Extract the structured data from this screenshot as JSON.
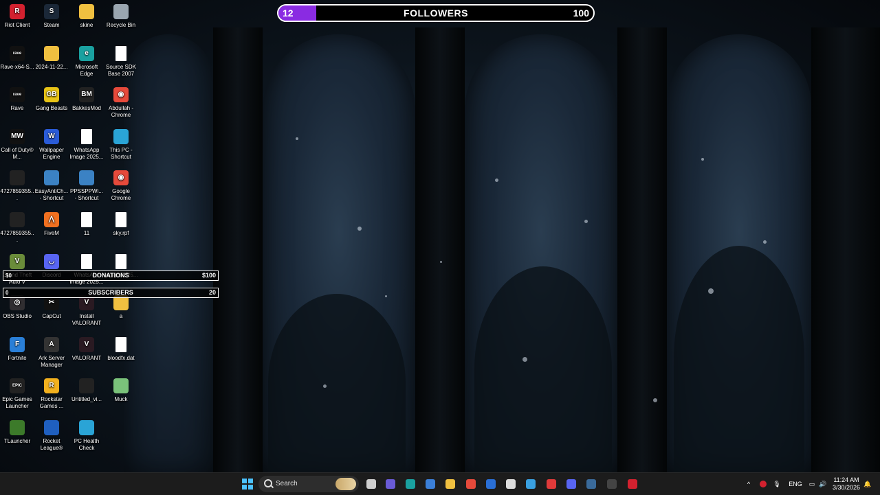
{
  "desktop_icons": [
    {
      "label": "Riot Client",
      "icon": "riot-client-icon",
      "color": "#d3212f",
      "glyph": "R"
    },
    {
      "label": "Steam",
      "icon": "steam-icon",
      "color": "#1b2838",
      "glyph": "S"
    },
    {
      "label": "skine",
      "icon": "folder-icon",
      "color": "#f0c040",
      "glyph": ""
    },
    {
      "label": "Recycle Bin",
      "icon": "recycle-bin-icon",
      "color": "#9aa6b0",
      "glyph": ""
    },
    {
      "label": "Rave-x64-S...",
      "icon": "rave-icon",
      "color": "#111111",
      "glyph": "rave"
    },
    {
      "label": "2024-11-22...",
      "icon": "folder-icon",
      "color": "#f0c040",
      "glyph": ""
    },
    {
      "label": "Microsoft Edge",
      "icon": "edge-icon",
      "color": "#1aa1a0",
      "glyph": "e"
    },
    {
      "label": "Source SDK Base 2007",
      "icon": "file-icon",
      "color": "#ffffff",
      "glyph": ""
    },
    {
      "label": "Rave",
      "icon": "rave-icon",
      "color": "#111111",
      "glyph": "rave"
    },
    {
      "label": "Gang Beasts",
      "icon": "gang-beasts-icon",
      "color": "#e7c316",
      "glyph": "GB"
    },
    {
      "label": "BakkesMod",
      "icon": "bakkesmod-icon",
      "color": "#222222",
      "glyph": "BM"
    },
    {
      "label": "Abdullah - Chrome",
      "icon": "chrome-icon",
      "color": "#e64a3b",
      "glyph": "◉"
    },
    {
      "label": "Call of Duty® M...",
      "icon": "call-of-duty-icon",
      "color": "#111111",
      "glyph": "MW"
    },
    {
      "label": "Wallpaper Engine",
      "icon": "wallpaper-engine-icon",
      "color": "#2a5bd7",
      "glyph": "W"
    },
    {
      "label": "WhatsApp Image 2025...",
      "icon": "image-file-icon",
      "color": "#ffffff",
      "glyph": ""
    },
    {
      "label": "This PC - Shortcut",
      "icon": "this-pc-icon",
      "color": "#2aa4d6",
      "glyph": ""
    },
    {
      "label": "4727859355...",
      "icon": "video-file-icon",
      "color": "#222222",
      "glyph": ""
    },
    {
      "label": "EasyAntiCh... - Shortcut",
      "icon": "easyanticheat-icon",
      "color": "#3b82c4",
      "glyph": ""
    },
    {
      "label": "PPSSPPWi... - Shortcut",
      "icon": "ppsspp-icon",
      "color": "#3b82c4",
      "glyph": ""
    },
    {
      "label": "Google Chrome",
      "icon": "chrome-icon",
      "color": "#e64a3b",
      "glyph": "◉"
    },
    {
      "label": "4727859355...",
      "icon": "video-file-icon",
      "color": "#222222",
      "glyph": ""
    },
    {
      "label": "FiveM",
      "icon": "fivem-icon",
      "color": "#f07020",
      "glyph": "⋀"
    },
    {
      "label": "11",
      "icon": "image-file-icon",
      "color": "#ffffff",
      "glyph": ""
    },
    {
      "label": "sky.rpf",
      "icon": "file-icon",
      "color": "#ffffff",
      "glyph": ""
    },
    {
      "label": "Grand Theft Auto V",
      "icon": "gta-v-icon",
      "color": "#6a8c3a",
      "glyph": "V"
    },
    {
      "label": "Discord",
      "icon": "discord-icon",
      "color": "#5865f2",
      "glyph": "◡"
    },
    {
      "label": "WhatsApp Image 2025...",
      "icon": "image-file-icon",
      "color": "#ffffff",
      "glyph": ""
    },
    {
      "label": "Image 2025...",
      "icon": "image-file-icon",
      "color": "#ffffff",
      "glyph": ""
    },
    {
      "label": "OBS Studio",
      "icon": "obs-studio-icon",
      "color": "#302e31",
      "glyph": "◎"
    },
    {
      "label": "CapCut",
      "icon": "capcut-icon",
      "color": "#111111",
      "glyph": "✂"
    },
    {
      "label": "Install VALORANT",
      "icon": "valorant-install-icon",
      "color": "#2a1a22",
      "glyph": "V"
    },
    {
      "label": "a",
      "icon": "folder-icon",
      "color": "#f0c040",
      "glyph": ""
    },
    {
      "label": "Fortnite",
      "icon": "fortnite-icon",
      "color": "#2a7fd7",
      "glyph": "F"
    },
    {
      "label": "Ark Server Manager",
      "icon": "ark-server-manager-icon",
      "color": "#333333",
      "glyph": "A"
    },
    {
      "label": "VALORANT",
      "icon": "valorant-icon",
      "color": "#2a1a22",
      "glyph": "V"
    },
    {
      "label": "bloodfx.dat",
      "icon": "file-icon",
      "color": "#ffffff",
      "glyph": ""
    },
    {
      "label": "Epic Games Launcher",
      "icon": "epic-games-icon",
      "color": "#222222",
      "glyph": "EPIC"
    },
    {
      "label": "Rockstar Games ...",
      "icon": "rockstar-icon",
      "color": "#f2b01e",
      "glyph": "R"
    },
    {
      "label": "Untitled_vi...",
      "icon": "video-file-icon",
      "color": "#222222",
      "glyph": ""
    },
    {
      "label": "Muck",
      "icon": "muck-icon",
      "color": "#7ac27a",
      "glyph": ""
    },
    {
      "label": "TLauncher",
      "icon": "tlauncher-icon",
      "color": "#3c7a2a",
      "glyph": ""
    },
    {
      "label": "Rocket League®",
      "icon": "rocket-league-icon",
      "color": "#1f5fbf",
      "glyph": ""
    },
    {
      "label": "PC Health Check",
      "icon": "pc-health-check-icon",
      "color": "#2aa4d6",
      "glyph": ""
    }
  ],
  "followers_goal": {
    "title": "FOLLOWERS",
    "current": "12",
    "goal": "100",
    "progress_fraction": 0.12,
    "fill_color": "#8a2be2"
  },
  "donations_goal": {
    "title": "DONATIONS",
    "current": "$0",
    "goal": "$100"
  },
  "subscribers_goal": {
    "title": "SUBSCRIBERS",
    "current": "0",
    "goal": "20"
  },
  "taskbar": {
    "search_label": "Search",
    "pinned": [
      {
        "name": "start-button",
        "icon": "windows-start-icon"
      },
      {
        "name": "task-view",
        "icon": "task-view-icon"
      },
      {
        "name": "copilot",
        "icon": "copilot-icon"
      },
      {
        "name": "edge",
        "icon": "edge-icon"
      },
      {
        "name": "microsoft-store",
        "icon": "store-icon"
      },
      {
        "name": "file-explorer",
        "icon": "folder-icon"
      },
      {
        "name": "chrome",
        "icon": "chrome-icon"
      },
      {
        "name": "mail",
        "icon": "mail-icon"
      },
      {
        "name": "capture",
        "icon": "capture-icon"
      },
      {
        "name": "network-app",
        "icon": "network-app-icon"
      },
      {
        "name": "valorant",
        "icon": "valorant-icon"
      },
      {
        "name": "discord",
        "icon": "discord-icon"
      },
      {
        "name": "steam",
        "icon": "steam-icon"
      },
      {
        "name": "obs",
        "icon": "obs-studio-icon"
      },
      {
        "name": "riot-client",
        "icon": "riot-client-icon"
      }
    ],
    "tray": {
      "chevron": "^",
      "language": "ENG"
    },
    "clock": {
      "time": "11:24 AM",
      "date": "3/30/2026"
    }
  }
}
